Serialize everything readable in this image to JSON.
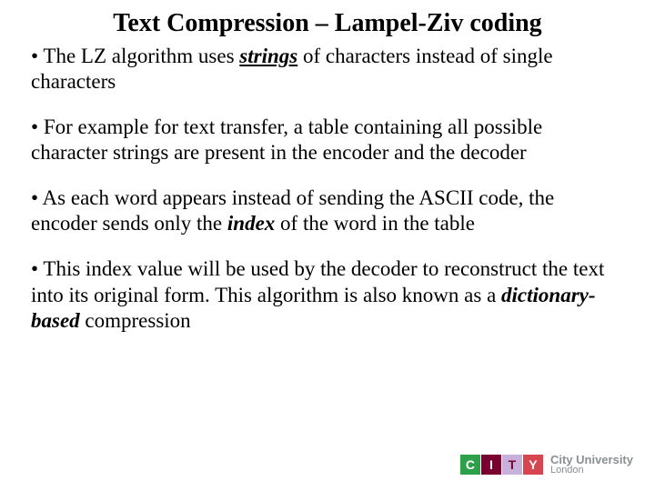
{
  "title": "Text Compression – Lampel-Ziv coding",
  "bullets": [
    {
      "pre": "The LZ algorithm uses ",
      "em": "strings",
      "post": " of characters instead of single characters",
      "emStyle": "u"
    },
    {
      "pre": "For example for text transfer, a table containing all possible character strings are present in the encoder and the decoder",
      "em": "",
      "post": ""
    },
    {
      "pre": "As each word appears instead of sending the ASCII code, the encoder sends only the ",
      "em": "index",
      "post": " of the word in the table",
      "emStyle": "plain"
    },
    {
      "pre": "This index value will be used by the decoder to reconstruct the text into its original form.  This algorithm is also known as a ",
      "em": "dictionary-based",
      "post": " compression",
      "emStyle": "plain"
    }
  ],
  "logo": {
    "tiles": [
      "C",
      "I",
      "T",
      "Y"
    ],
    "line1": "City University",
    "line2": "London"
  }
}
